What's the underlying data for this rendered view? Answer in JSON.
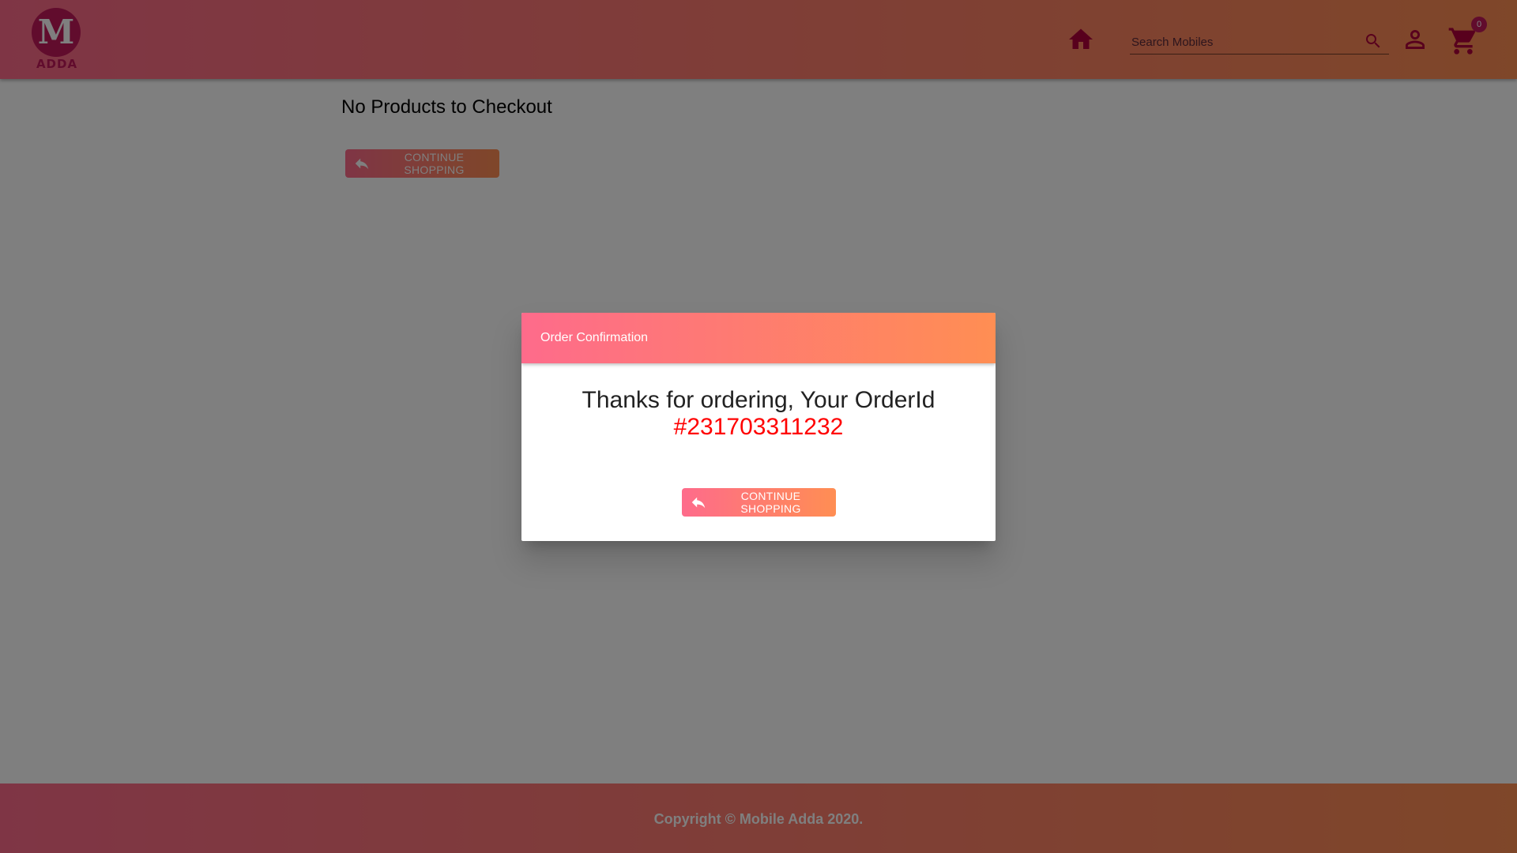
{
  "header": {
    "logo_letter": "M",
    "logo_tagline": "ADDA",
    "search_placeholder": "Search Mobiles",
    "cart_count": "0",
    "icons": [
      "home-icon",
      "search-icon",
      "account-icon",
      "cart-icon"
    ]
  },
  "main": {
    "message": "No Products to Checkout",
    "continue_label": "CONTINUE SHOPPING"
  },
  "dialog": {
    "title": "Order Confirmation",
    "thanks_text": "Thanks for ordering, Your OrderId",
    "order_id": "#231703311232",
    "continue_label": "CONTINUE SHOPPING"
  },
  "footer": {
    "copyright": "Copyright © Mobile Adda 2020."
  },
  "colors": {
    "gradient_start": "#fe6b8b",
    "gradient_end": "#ff8e53",
    "brand": "#c2185b",
    "order_id": "#ff0000"
  }
}
